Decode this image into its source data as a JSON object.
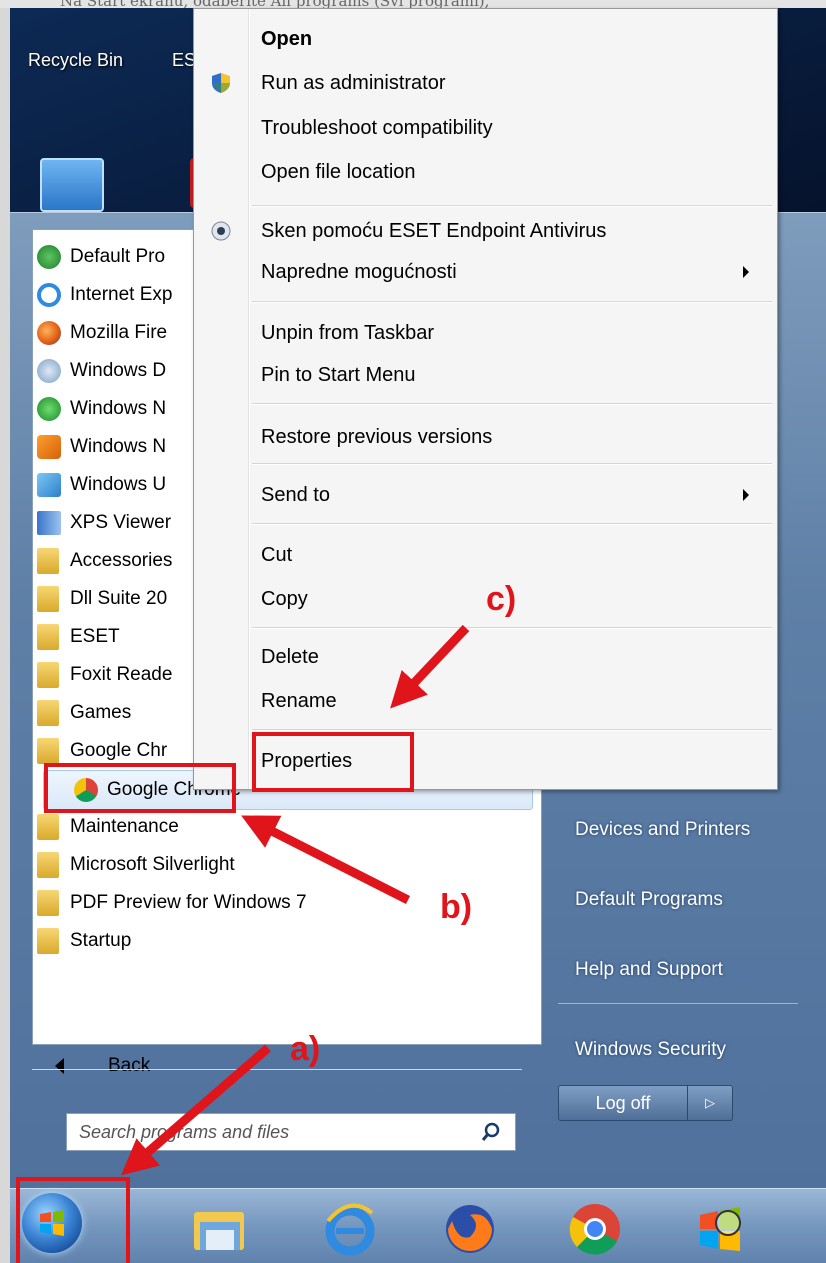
{
  "caption": "Na Start ekranu, odaberite All programs (Svi programi),",
  "desktop": {
    "icons": [
      {
        "label": "Recycle Bin"
      },
      {
        "label": "ES"
      }
    ]
  },
  "start_menu": {
    "programs": [
      {
        "label": "Default Pro",
        "icon": "default-programs-icon",
        "type": "app"
      },
      {
        "label": "Internet Exp",
        "icon": "internet-explorer-icon",
        "type": "app"
      },
      {
        "label": "Mozilla Fire",
        "icon": "firefox-icon",
        "type": "app"
      },
      {
        "label": "Windows D",
        "icon": "windows-dvd-maker-icon",
        "type": "app"
      },
      {
        "label": "Windows N",
        "icon": "windows-media-center-icon",
        "type": "app"
      },
      {
        "label": "Windows N",
        "icon": "windows-media-player-icon",
        "type": "app"
      },
      {
        "label": "Windows U",
        "icon": "windows-update-icon",
        "type": "app"
      },
      {
        "label": "XPS Viewer",
        "icon": "xps-viewer-icon",
        "type": "app"
      },
      {
        "label": "Accessories",
        "icon": "folder-icon",
        "type": "folder"
      },
      {
        "label": "Dll Suite 20",
        "icon": "folder-icon",
        "type": "folder"
      },
      {
        "label": "ESET",
        "icon": "folder-icon",
        "type": "folder"
      },
      {
        "label": "Foxit Reade",
        "icon": "folder-icon",
        "type": "folder"
      },
      {
        "label": "Games",
        "icon": "folder-icon",
        "type": "folder"
      },
      {
        "label": "Google Chr",
        "icon": "folder-icon",
        "type": "folder"
      },
      {
        "label": "Google Chrome",
        "icon": "chrome-icon",
        "type": "app",
        "highlighted": true
      },
      {
        "label": "Maintenance",
        "icon": "folder-icon",
        "type": "folder"
      },
      {
        "label": "Microsoft Silverlight",
        "icon": "folder-icon",
        "type": "folder"
      },
      {
        "label": "PDF Preview for Windows 7",
        "icon": "folder-icon",
        "type": "folder"
      },
      {
        "label": "Startup",
        "icon": "folder-icon",
        "type": "folder"
      }
    ],
    "back_label": "Back",
    "search_placeholder": "Search programs and files",
    "right_links": [
      "Devices and Printers",
      "Default Programs",
      "Help and Support",
      "Windows Security"
    ],
    "logoff_label": "Log off"
  },
  "context_menu": {
    "items": [
      {
        "label": "Open",
        "bold": true
      },
      {
        "label": "Run as administrator",
        "icon": "uac-shield-icon"
      },
      {
        "label": "Troubleshoot compatibility"
      },
      {
        "label": "Open file location"
      },
      {
        "label": "Sken pomoću ESET Endpoint Antivirus",
        "icon": "eset-icon"
      },
      {
        "label": "Napredne mogućnosti",
        "submenu": true
      },
      {
        "label": "Unpin from Taskbar"
      },
      {
        "label": "Pin to Start Menu"
      },
      {
        "label": "Restore previous versions"
      },
      {
        "label": "Send to",
        "submenu": true
      },
      {
        "label": "Cut"
      },
      {
        "label": "Copy"
      },
      {
        "label": "Delete"
      },
      {
        "label": "Rename"
      },
      {
        "label": "Properties"
      }
    ]
  },
  "taskbar": {
    "items": [
      "start-orb-icon",
      "file-explorer-icon",
      "internet-explorer-icon",
      "firefox-icon",
      "chrome-icon",
      "windows-dvd-maker-icon"
    ]
  },
  "annotations": {
    "a": "a)",
    "b": "b)",
    "c": "c)"
  },
  "colors": {
    "annotation_red": "#e0141b",
    "start_menu_blue": "#5e7fa6"
  }
}
